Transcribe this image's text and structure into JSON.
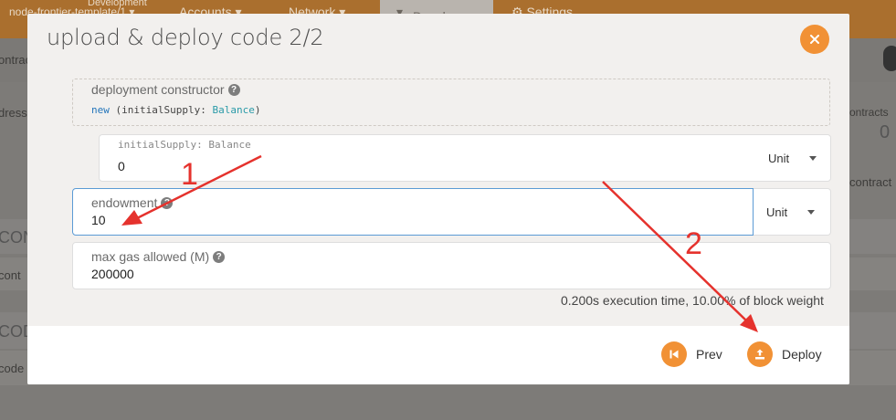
{
  "background": {
    "nav": {
      "node_small": "Development",
      "node": "node-frontier-template/1",
      "accounts": "Accounts",
      "network": "Network",
      "developer": "Developer",
      "settings": "Settings"
    },
    "left_fragments": [
      "ontrac",
      "dresse",
      "CON",
      "cont",
      "COD",
      "code"
    ],
    "right_fragments": [
      "ontracts",
      "0",
      "contract"
    ]
  },
  "modal": {
    "title": "upload & deploy code 2/2",
    "constructor": {
      "label": "deployment constructor",
      "signature_keyword": "new",
      "signature_open": " (initialSupply: ",
      "signature_type": "Balance",
      "signature_close": ")"
    },
    "initial_supply": {
      "label": "initialSupply: Balance",
      "value": "0",
      "unit": "Unit"
    },
    "endowment": {
      "label": "endowment",
      "value": "10",
      "unit": "Unit"
    },
    "max_gas": {
      "label": "max gas allowed (M)",
      "value": "200000"
    },
    "execution_info": "0.200s execution time, 10.00% of block weight",
    "buttons": {
      "prev": "Prev",
      "deploy": "Deploy"
    }
  },
  "annotations": {
    "numbers": [
      "1",
      "2"
    ],
    "color": "#e5322d"
  },
  "colors": {
    "accent": "#f19135",
    "active_border": "#5b9bd5"
  }
}
